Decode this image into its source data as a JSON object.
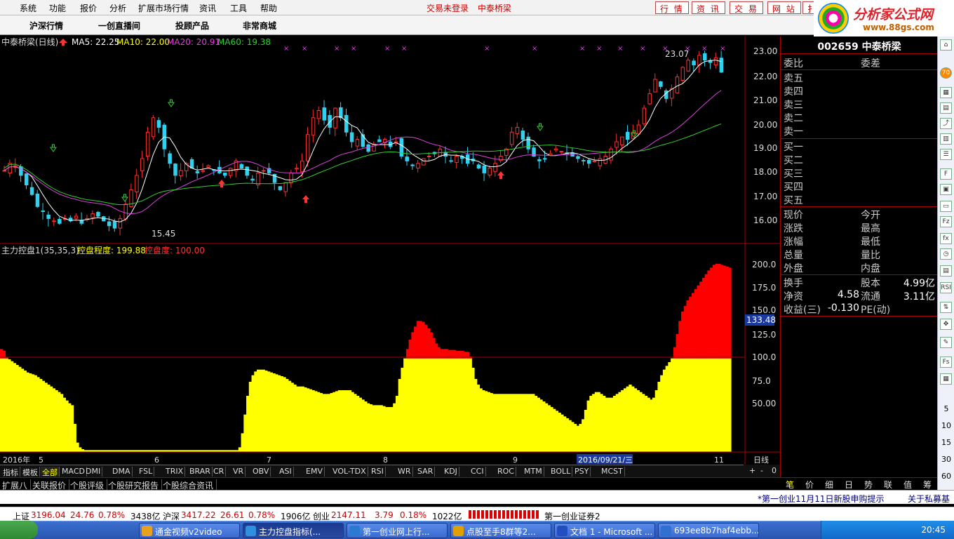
{
  "menu": {
    "items": [
      "系统",
      "功能",
      "报价",
      "分析",
      "扩展市场行情",
      "资讯",
      "工具",
      "帮助"
    ],
    "status1": "交易未登录",
    "status2": "中泰桥梁",
    "right_buttons": [
      "行 情",
      "资 讯",
      "交 易",
      "网 站",
      "扌"
    ]
  },
  "logo": {
    "title": "分析家公式网",
    "url": "www.88gs.com"
  },
  "tabs": [
    "沪深行情",
    "一创直播间",
    "投顾产品",
    "非常商城"
  ],
  "chart": {
    "header": {
      "stock": "中泰桥梁(日线)",
      "ma5": "MA5: 22.25",
      "ma10": "MA10: 22.00",
      "ma20": "MA20: 20.91",
      "ma60": "MA60: 19.38"
    },
    "price_ticks": [
      "23.00",
      "22.00",
      "21.00",
      "20.00",
      "19.00",
      "18.00",
      "17.00",
      "16.00"
    ],
    "high_label": "23.07",
    "low_label": "15.45",
    "sub_header": {
      "name": "主力控盘1(35,35,3)",
      "v1": "控盘程度: 199.88",
      "v2": "控盘度: 100.00"
    },
    "sub_ticks": [
      "200.0",
      "175.0",
      "150.0",
      "125.0",
      "100.0",
      "75.0",
      "50.00"
    ],
    "cursor_value": "133.48",
    "date_labels": [
      "2016年",
      "5",
      "6",
      "7",
      "8",
      "9",
      "2016/09/21/三",
      "11"
    ],
    "period": "日线",
    "colors": {
      "up": "#ff3030",
      "down": "#30d0f0",
      "ma5": "#ffffff",
      "ma10": "#ffff40",
      "ma20": "#e040e0",
      "ma60": "#30d030",
      "fill_high": "#ff0000",
      "fill_low": "#ffff00"
    }
  },
  "chart_data": {
    "type": "area",
    "title": "主力控盘1(35,35,3)",
    "ylim": [
      0,
      210
    ],
    "threshold": 100,
    "values": [
      110,
      108,
      101,
      99,
      97,
      95,
      93,
      91,
      89,
      87,
      85,
      84,
      83,
      82,
      80,
      78,
      76,
      74,
      72,
      70,
      68,
      66,
      64,
      62,
      58,
      55,
      52,
      50,
      30,
      10,
      5,
      3,
      2,
      2,
      2,
      2,
      2,
      2,
      2,
      2,
      2,
      2,
      2,
      2,
      2,
      2,
      2,
      2,
      2,
      2,
      2,
      2,
      2,
      2,
      2,
      2,
      2,
      2,
      2,
      2,
      2,
      2,
      2,
      2,
      2,
      2,
      2,
      2,
      2,
      2,
      2,
      2,
      2,
      2,
      2,
      2,
      2,
      2,
      2,
      2,
      2,
      2,
      2,
      2,
      2,
      2,
      2,
      2,
      2,
      2,
      2,
      5,
      20,
      40,
      60,
      75,
      82,
      86,
      88,
      88,
      88,
      87,
      86,
      85,
      84,
      83,
      82,
      81,
      80,
      78,
      76,
      74,
      72,
      70,
      70,
      70,
      69,
      68,
      67,
      66,
      65,
      64,
      63,
      62,
      62,
      62,
      63,
      64,
      65,
      66,
      66,
      66,
      66,
      66,
      64,
      62,
      60,
      58,
      56,
      54,
      52,
      51,
      50,
      50,
      50,
      50,
      49,
      48,
      48,
      48,
      52,
      60,
      78,
      90,
      100,
      110,
      120,
      128,
      134,
      140,
      140,
      139,
      136,
      132,
      128,
      122,
      116,
      112,
      110,
      110,
      110,
      109,
      109,
      109,
      108,
      108,
      108,
      107,
      107,
      102,
      90,
      78,
      72,
      68,
      66,
      65,
      64,
      63,
      62,
      62,
      62,
      62,
      62,
      62,
      62,
      62,
      62,
      62,
      62,
      62,
      62,
      62,
      62,
      62,
      60,
      58,
      56,
      54,
      52,
      50,
      48,
      46,
      44,
      42,
      40,
      38,
      36,
      34,
      32,
      30,
      28,
      30,
      35,
      45,
      55,
      60,
      62,
      64,
      64,
      62,
      60,
      58,
      58,
      58,
      60,
      62,
      64,
      66,
      68,
      70,
      72,
      70,
      68,
      66,
      64,
      62,
      60,
      58,
      56,
      58,
      66,
      75,
      82,
      88,
      92,
      96,
      100,
      112,
      126,
      140,
      150,
      156,
      162,
      166,
      170,
      174,
      178,
      182,
      186,
      190,
      194,
      197,
      200,
      201,
      201,
      200,
      199,
      198,
      197
    ]
  },
  "right_panel": {
    "code": "002659",
    "name": "中泰桥梁",
    "row1": [
      "委比",
      "委差"
    ],
    "sell": [
      "卖五",
      "卖四",
      "卖三",
      "卖二",
      "卖一"
    ],
    "buy": [
      "买一",
      "买二",
      "买三",
      "买四",
      "买五"
    ],
    "quote_left": [
      "现价",
      "涨跌",
      "涨幅",
      "总量",
      "外盘"
    ],
    "quote_right": [
      "今开",
      "最高",
      "最低",
      "量比",
      "内盘"
    ],
    "stats": [
      [
        "换手",
        "股本",
        "4.99亿"
      ],
      [
        "净资",
        "4.58",
        "流通",
        "3.11亿"
      ],
      [
        "收益(三)",
        "-0.130",
        "PE(动)"
      ]
    ],
    "bottom_tabs": [
      "笔",
      "价",
      "细",
      "日",
      "势",
      "联",
      "值",
      "筹"
    ]
  },
  "indicators": [
    "指标",
    "模板",
    "全部",
    "MACD",
    "DMI",
    "DMA",
    "FSL",
    "TRIX",
    "BRAR",
    "CR",
    "VR",
    "OBV",
    "ASI",
    "EMV",
    "VOL-TDX",
    "RSI",
    "WR",
    "SAR",
    "KDJ",
    "CCI",
    "ROC",
    "MTM",
    "BOLL",
    "PSY",
    "MCST"
  ],
  "right_controls": [
    "+",
    "-",
    "0"
  ],
  "context_tabs": [
    "扩展八",
    "关联报价",
    "个股评级",
    "个股研究报告",
    "个股综合资讯"
  ],
  "news": {
    "item1": "*第一创业11月11日新股申购提示",
    "item2": "关于私募基"
  },
  "status": {
    "sh_label": "上证",
    "sh_value": "3196.04",
    "sh_change": "24.76",
    "sh_pct": "0.78%",
    "sh_amt": "3438亿",
    "hs_label": "沪深",
    "hs_value": "3417.22",
    "hs_change": "26.61",
    "hs_pct": "0.78%",
    "hs_amt": "1906亿",
    "cy_label": "创业",
    "cy_value": "2147.11",
    "cy_change": "3.79",
    "cy_pct": "0.18%",
    "cy_amt": "1022亿",
    "broker": "第一创业证券2"
  },
  "sidebar": {
    "badge": "70",
    "nums": [
      "5",
      "10",
      "15",
      "30",
      "60"
    ]
  },
  "taskbar": {
    "items": [
      "通金视频v2video",
      "主力控盘指标(...",
      "第一创业网上行...",
      "点股至手8群等2...",
      "文档 1 - Microsoft ...",
      "693ee8b7haf4ebb..."
    ],
    "time": "20:45"
  }
}
